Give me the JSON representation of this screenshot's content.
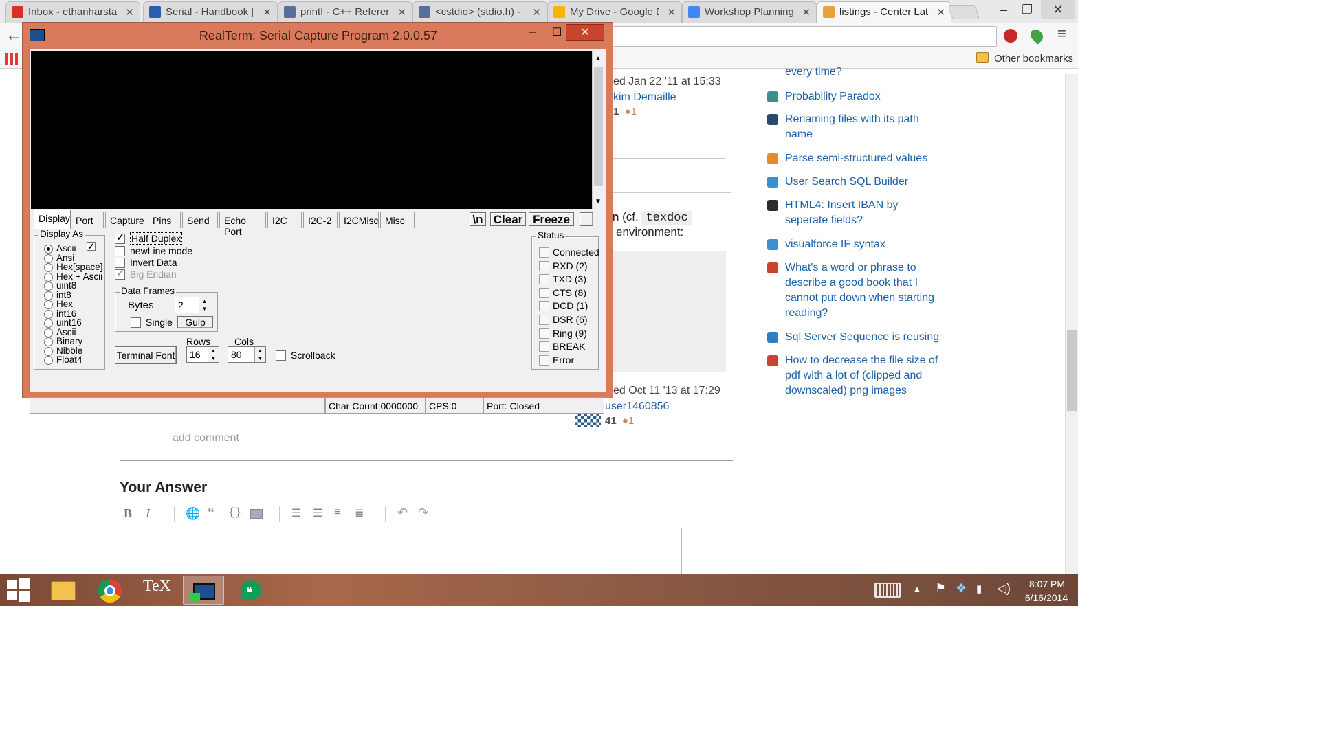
{
  "browser": {
    "tabs": [
      {
        "title": "Inbox - ethanharsta",
        "icon": "gmail-icon",
        "color": "#d93025"
      },
      {
        "title": "Serial - Handbook |",
        "icon": "handbook-icon",
        "color": "#2a5db0"
      },
      {
        "title": "printf - C++ Referer",
        "icon": "cplusplus-icon",
        "color": "#5a6e9e"
      },
      {
        "title": "<cstdio> (stdio.h) -",
        "icon": "cplusplus-icon",
        "color": "#5a6e9e"
      },
      {
        "title": "My Drive - Google D",
        "icon": "google-drive-icon",
        "color": "#f4b400"
      },
      {
        "title": "Workshop Planning",
        "icon": "google-docs-icon",
        "color": "#4285f4"
      },
      {
        "title": "listings - Center Lat",
        "icon": "stackexchange-icon",
        "color": "#e8a23a"
      }
    ],
    "bookmarks": {
      "other": "Other bookmarks"
    }
  },
  "page": {
    "post1": {
      "edited": "ed Jan 22 '11 at 15:33",
      "user": "kim Demaille",
      "rep": "1",
      "bronze": "1"
    },
    "answer": {
      "text_bold": "n",
      "text_cf": "(cf.",
      "code": "texdoc",
      "text2": "environment:"
    },
    "post2": {
      "edited": "ed Oct 11 '13 at 17:29",
      "user": "user1460856",
      "rep": "41",
      "bronze": "1"
    },
    "add_comment": "add comment",
    "your_answer": "Your Answer",
    "editor_buttons": [
      "B",
      "I"
    ],
    "sidebar_top": "every time?",
    "sidebar": [
      {
        "text": [
          "Probability Paradox"
        ],
        "icon": "stats-icon",
        "color": "#3c8f8a"
      },
      {
        "text": [
          "Renaming files with its path",
          "name"
        ],
        "icon": "unix-icon",
        "color": "#2b4a6b"
      },
      {
        "text": [
          "Parse semi-structured values"
        ],
        "icon": "stackoverflow-icon",
        "color": "#e38a2c"
      },
      {
        "text": [
          "User Search SQL Builder"
        ],
        "icon": "coderview-icon",
        "color": "#3a8fd0"
      },
      {
        "text": [
          "HTML4: Insert IBAN by",
          "seperate fields?"
        ],
        "icon": "ux-icon",
        "color": "#2b2b2b"
      },
      {
        "text": [
          "visualforce IF syntax"
        ],
        "icon": "salesforce-icon",
        "color": "#3a8fd0"
      },
      {
        "text": [
          "What's a word or phrase to",
          "describe a good book that I",
          "cannot put down when starting",
          "reading?"
        ],
        "icon": "english-icon",
        "color": "#c8442f"
      },
      {
        "text": [
          "Sql Server Sequence is reusing"
        ],
        "icon": "dba-icon",
        "color": "#2a7fc8"
      },
      {
        "text": [
          "How to decrease the file size of",
          "pdf with a lot of (clipped and",
          "downscaled) png images"
        ],
        "icon": "tex-icon",
        "color": "#c8442f"
      }
    ]
  },
  "realterm": {
    "title": "RealTerm: Serial Capture Program 2.0.0.57",
    "tabs": [
      "Display",
      "Port",
      "Capture",
      "Pins",
      "Send",
      "Echo Port",
      "I2C",
      "I2C-2",
      "I2CMisc",
      "Misc"
    ],
    "buttons": {
      "newline": "\\n",
      "clear": "Clear",
      "freeze": "Freeze"
    },
    "display_as": {
      "label": "Display As",
      "options": [
        "Ascii",
        "Ansi",
        "Hex[space]",
        "Hex + Ascii",
        "uint8",
        "int8",
        "Hex",
        "int16",
        "uint16",
        "Ascii",
        "Binary",
        "Nibble",
        "Float4"
      ],
      "selected": "Ascii"
    },
    "options": {
      "half_duplex": "Half Duplex",
      "newline_mode": "newLine mode",
      "invert_data": "Invert Data",
      "big_endian": "Big Endian"
    },
    "data_frames": {
      "label": "Data Frames",
      "bytes_label": "Bytes",
      "bytes": "2",
      "single": "Single",
      "gulp": "Gulp"
    },
    "terminal_font": "Terminal Font",
    "rows": {
      "label": "Rows",
      "value": "16"
    },
    "cols": {
      "label": "Cols",
      "value": "80"
    },
    "scrollback": "Scrollback",
    "status": {
      "label": "Status",
      "items": [
        "Connected",
        "RXD (2)",
        "TXD (3)",
        "CTS (8)",
        "DCD (1)",
        "DSR (6)",
        "Ring (9)",
        "BREAK",
        "Error"
      ]
    },
    "statusbar": {
      "char_count": "Char Count:0000000",
      "cps": "CPS:0",
      "port": "Port: Closed"
    }
  },
  "taskbar": {
    "apps": [
      {
        "name": "file-explorer"
      },
      {
        "name": "chrome"
      },
      {
        "name": "tex",
        "label": "TeX"
      },
      {
        "name": "realterm"
      },
      {
        "name": "hangouts"
      }
    ],
    "time": "8:07 PM",
    "date": "6/16/2014"
  }
}
